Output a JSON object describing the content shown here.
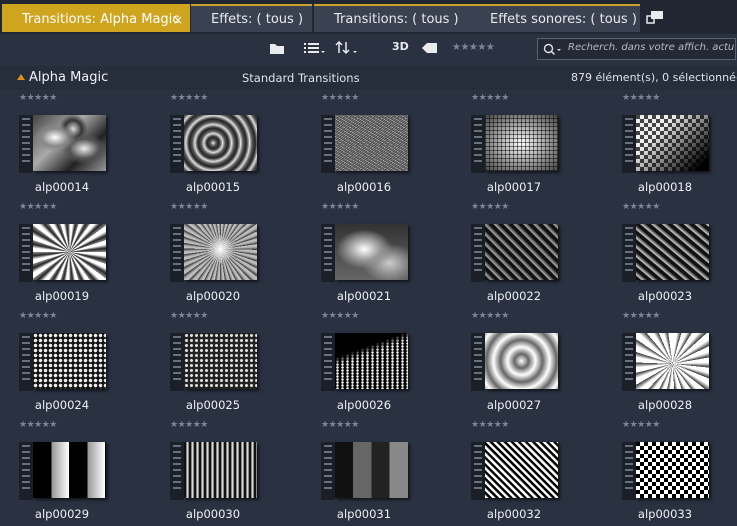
{
  "tabs": [
    {
      "label": "Transitions: Alpha Magic",
      "active": true,
      "close": "×"
    },
    {
      "label": "Effets: ( tous )"
    },
    {
      "label": "Transitions: ( tous )"
    },
    {
      "label": "Effets sonores: ( tous )"
    }
  ],
  "toolbar": {
    "label_3d": "3D",
    "rating": "★★★★★",
    "search_placeholder": "Recherch. dans votre affich. actu"
  },
  "header": {
    "title": "Alpha Magic",
    "subtitle": "Standard Transitions",
    "count": "879 élément(s), 0 sélectionné(s)"
  },
  "rating": "★★★★★",
  "items": [
    {
      "name": "alp00014",
      "pattern": "cloud"
    },
    {
      "name": "alp00015",
      "pattern": "rock"
    },
    {
      "name": "alp00016",
      "pattern": "noise"
    },
    {
      "name": "alp00017",
      "pattern": "grid-noise"
    },
    {
      "name": "alp00018",
      "pattern": "checker-fade"
    },
    {
      "name": "alp00019",
      "pattern": "swirl"
    },
    {
      "name": "alp00020",
      "pattern": "burst"
    },
    {
      "name": "alp00021",
      "pattern": "smoke"
    },
    {
      "name": "alp00022",
      "pattern": "diagonal-bars"
    },
    {
      "name": "alp00023",
      "pattern": "diagonal-bars-2"
    },
    {
      "name": "alp00024",
      "pattern": "dots-grid"
    },
    {
      "name": "alp00025",
      "pattern": "dots-grid-2"
    },
    {
      "name": "alp00026",
      "pattern": "perspective-dots"
    },
    {
      "name": "alp00027",
      "pattern": "rings"
    },
    {
      "name": "alp00028",
      "pattern": "rays"
    },
    {
      "name": "alp00029",
      "pattern": "wide-bars"
    },
    {
      "name": "alp00030",
      "pattern": "thin-bars"
    },
    {
      "name": "alp00031",
      "pattern": "steps"
    },
    {
      "name": "alp00032",
      "pattern": "diamonds"
    },
    {
      "name": "alp00033",
      "pattern": "checker"
    }
  ]
}
